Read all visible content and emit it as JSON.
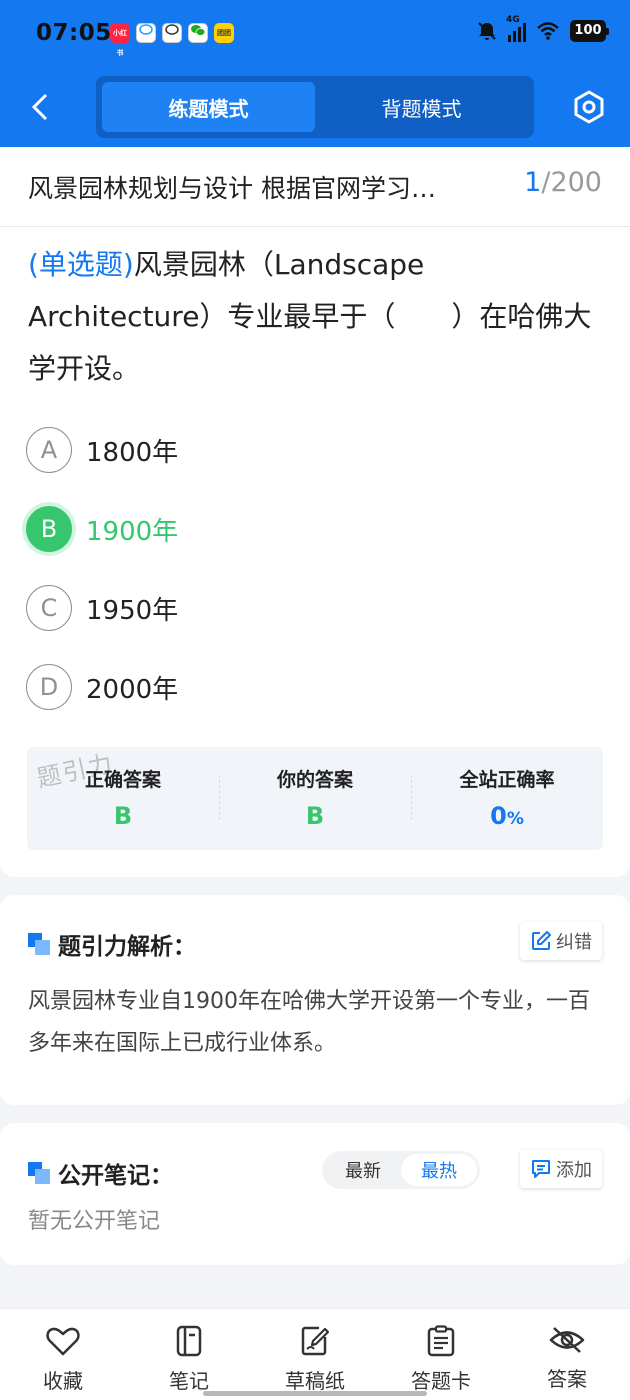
{
  "status_bar": {
    "time": "07:05",
    "network": "4G",
    "battery": "100",
    "apps": [
      {
        "name": "xiaohongshu-app-icon",
        "label": "小红书",
        "color": "#ff2442"
      },
      {
        "name": "chat-bubble-app-icon",
        "label": "",
        "color": "#ffffff"
      },
      {
        "name": "chat-search-app-icon",
        "label": "",
        "color": "#ffffff"
      },
      {
        "name": "wechat-app-icon",
        "label": "",
        "color": "#ffffff"
      },
      {
        "name": "meituan-app-icon",
        "label": "团团",
        "color": "#ffd100"
      }
    ]
  },
  "header": {
    "tabs": [
      {
        "label": "练题模式",
        "active": true
      },
      {
        "label": "背题模式",
        "active": false
      }
    ]
  },
  "question": {
    "title": "风景园林规划与设计 根据官网学习…",
    "current": "1",
    "separator": "/",
    "total": "200",
    "type_label": "(单选题)",
    "text": "风景园林（Landscape Architecture）专业最早于（　　）在哈佛大学开设。",
    "options": [
      {
        "letter": "A",
        "text": "1800年",
        "correct": false
      },
      {
        "letter": "B",
        "text": "1900年",
        "correct": true
      },
      {
        "letter": "C",
        "text": "1950年",
        "correct": false
      },
      {
        "letter": "D",
        "text": "2000年",
        "correct": false
      }
    ]
  },
  "answer_summary": {
    "watermark": "题引力",
    "correct_label": "正确答案",
    "correct_value": "B",
    "yours_label": "你的答案",
    "yours_value": "B",
    "rate_label": "全站正确率",
    "rate_value": "0",
    "rate_unit": "%"
  },
  "analysis": {
    "title": "题引力解析：",
    "report_label": "纠错",
    "text": "风景园林专业自1900年在哈佛大学开设第一个专业，一百多年来在国际上已成行业体系。"
  },
  "notes": {
    "title": "公开笔记：",
    "sort_options": [
      {
        "label": "最新",
        "active": false
      },
      {
        "label": "最热",
        "active": true
      }
    ],
    "add_label": "添加",
    "empty_text": "暂无公开笔记"
  },
  "bottom_nav": [
    {
      "label": "收藏",
      "icon": "heart-icon"
    },
    {
      "label": "笔记",
      "icon": "notebook-icon"
    },
    {
      "label": "草稿纸",
      "icon": "draft-paper-icon"
    },
    {
      "label": "答题卡",
      "icon": "answer-card-icon"
    },
    {
      "label": "答案",
      "icon": "eye-off-icon"
    }
  ],
  "colors": {
    "brand_blue": "#1478f0",
    "correct_green": "#36c76e"
  }
}
